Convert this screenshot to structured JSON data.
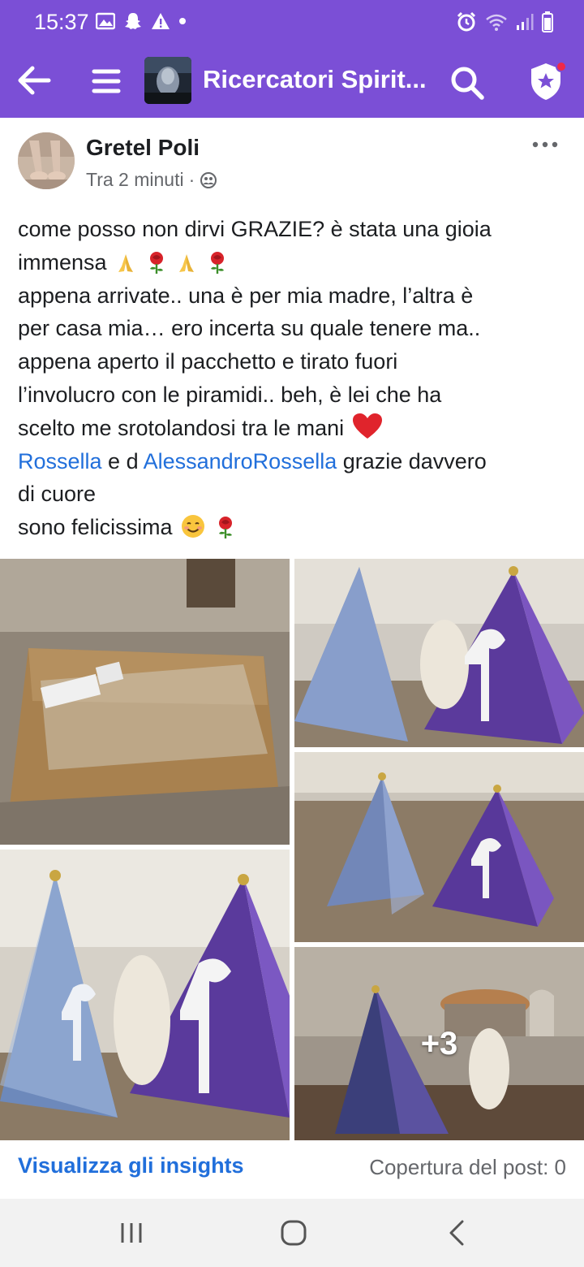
{
  "status_bar": {
    "time": "15:37"
  },
  "app_bar": {
    "title": "Ricercatori Spirit...",
    "accent_color": "#7b4fd6"
  },
  "post": {
    "author": "Gretel Poli",
    "time": "Tra 2 minuti",
    "meta_separator": "·",
    "lines": {
      "l1": "come posso non dirvi GRAZIE? è stata una gioia",
      "l2": "immensa",
      "l3": "appena arrivate.. una è per mia madre, l’altra è",
      "l4": "per casa mia… ero incerta su quale tenere ma..",
      "l5": "appena aperto il pacchetto e tirato fuori",
      "l6": "l’involucro con le piramidi.. beh, è lei che ha",
      "l7": "scelto me srotolandosi tra le mani",
      "l8_mention1": "Rossella",
      "l8_mid": " e d ",
      "l8_mention2": "AlessandroRossella",
      "l8_end": " grazie davvero",
      "l9": "di cuore",
      "l10": "sono felicissima"
    },
    "emojis": [
      "folded-hands",
      "rose",
      "folded-hands",
      "rose",
      "red-heart",
      "smiling-face",
      "rose"
    ],
    "photos_more": "+3"
  },
  "footer": {
    "insights_label": "Visualizza gli insights",
    "reach_label": "Copertura del post: 0"
  },
  "nav": {
    "icons": [
      "recent-apps-icon",
      "home-icon",
      "back-icon"
    ]
  }
}
